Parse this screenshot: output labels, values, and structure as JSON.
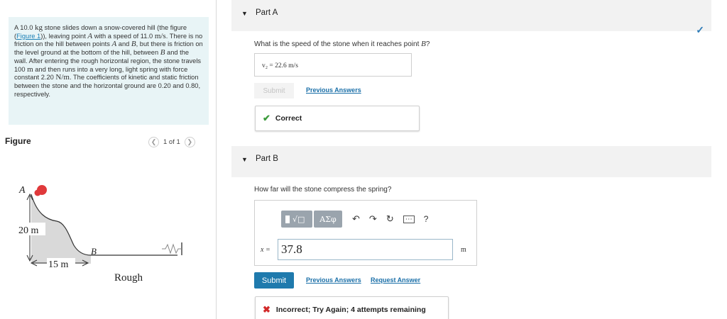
{
  "problem": {
    "text_1": "A 10.0 ",
    "unit_kg": "kg",
    "text_2": " stone slides down a snow-covered hill (the figure (",
    "figure_link": "Figure 1",
    "text_3": ")), leaving point ",
    "point_a": "A",
    "text_4": " with a speed of 11.0 ",
    "unit_ms": "m/s",
    "text_5": ". There is no friction on the hill between points ",
    "point_a2": "A",
    "text_6": " and ",
    "point_b": "B",
    "text_7": ", but there is friction on the level ground at the bottom of the hill, between ",
    "point_b2": "B",
    "text_8": " and the wall. After entering the rough horizontal region, the stone travels 100 ",
    "unit_m": "m",
    "text_9": " and then runs into a very long, light spring with force constant 2.20 ",
    "unit_nm": "N/m",
    "text_10": ". The coefficients of kinetic and static friction between the stone and the horizontal ground are 0.20 and 0.80, respectively."
  },
  "figure": {
    "title": "Figure",
    "pager": "1 of 1",
    "label_a": "A",
    "label_height": "20 m",
    "label_b": "B",
    "label_width": "15 m",
    "label_rough": "Rough"
  },
  "part_a": {
    "label": "Part A",
    "question_pre": "What is the speed of the stone when it reaches point ",
    "question_var": "B",
    "question_post": "?",
    "answer": "v₂ =  22.6  m/s",
    "submit": "Submit",
    "previous": "Previous Answers",
    "feedback": "Correct"
  },
  "part_b": {
    "label": "Part B",
    "question": "How far will the stone compress the spring?",
    "toolbar": {
      "templates": "√□",
      "greek": "ΑΣφ",
      "help": "?"
    },
    "var_label": "x =",
    "value": "37.8",
    "unit": "m",
    "submit": "Submit",
    "previous": "Previous Answers",
    "request": "Request Answer",
    "feedback": "Incorrect; Try Again; 4 attempts remaining"
  },
  "colors": {
    "accent": "#1f7aad",
    "problem_bg": "#e8f4f6",
    "correct": "#3c9b3c",
    "incorrect": "#d22a2a",
    "stone": "#e0393b"
  }
}
